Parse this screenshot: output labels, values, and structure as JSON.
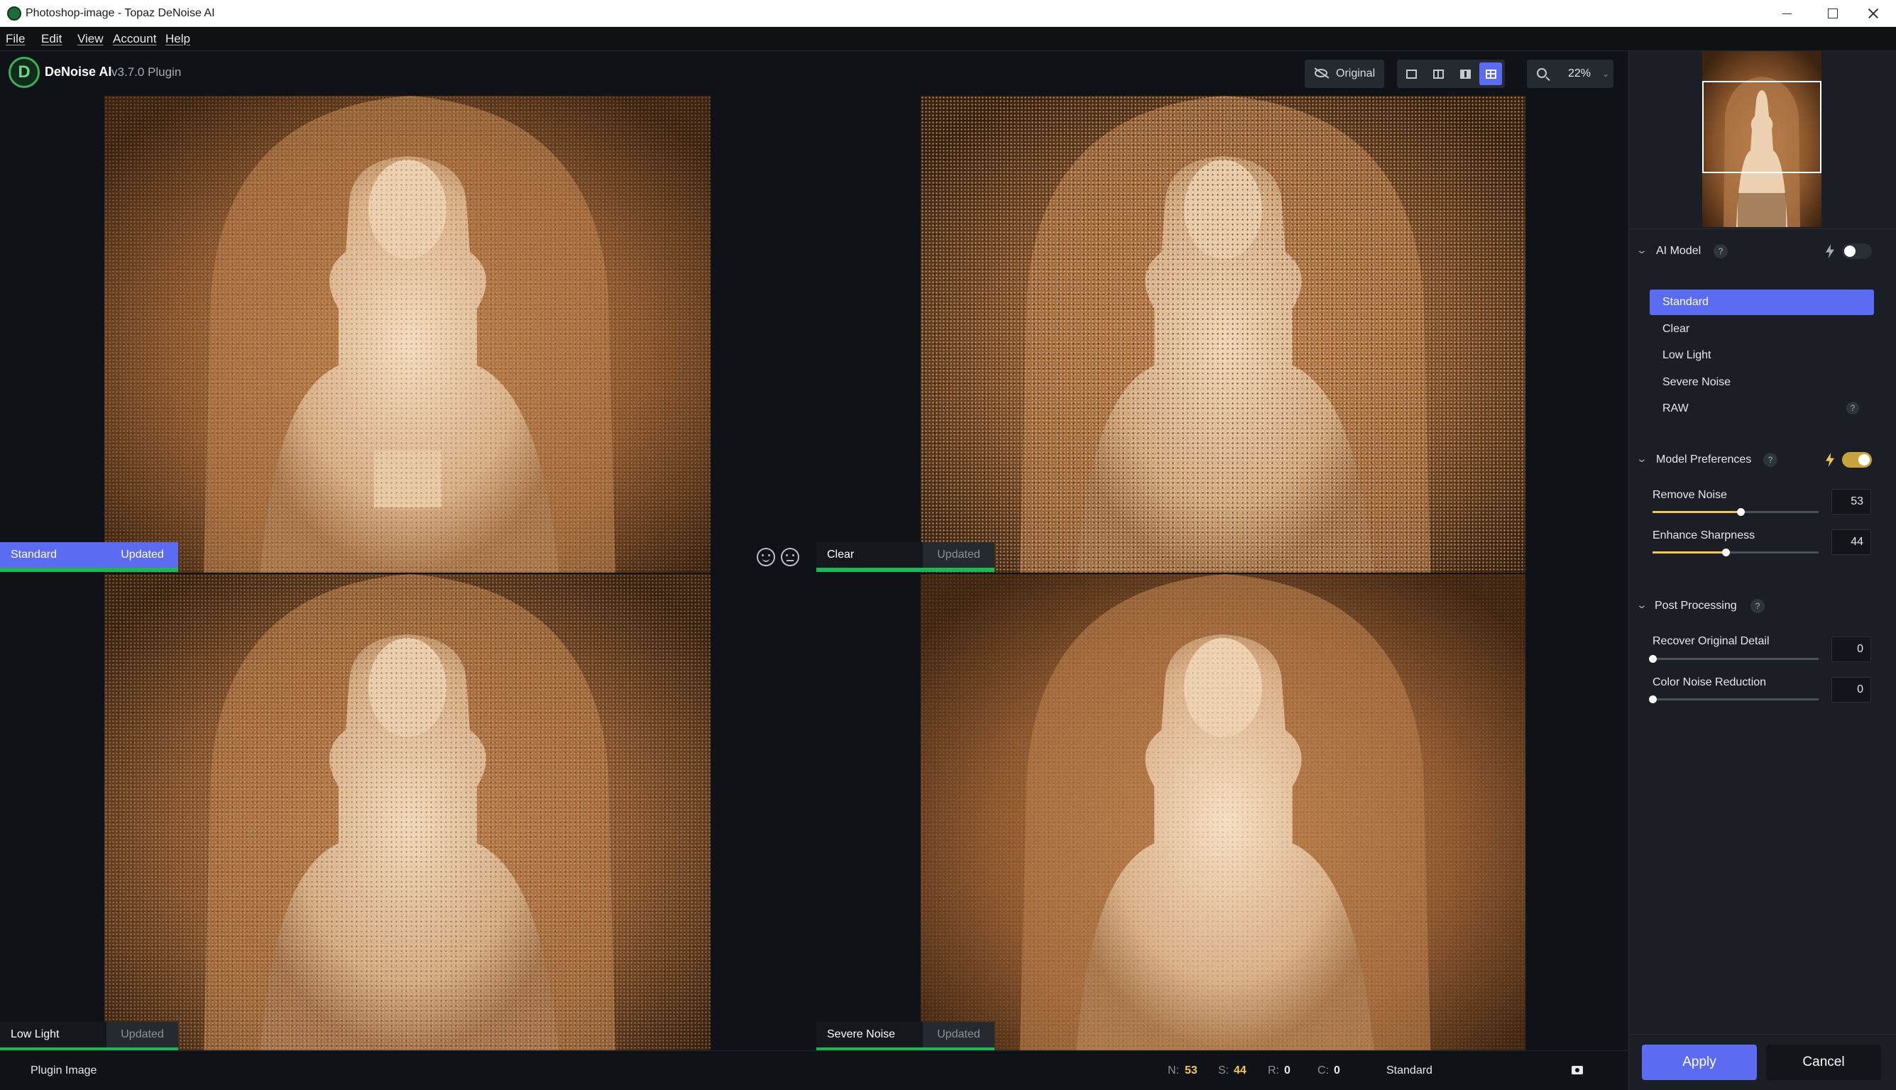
{
  "window": {
    "title": "Photoshop-image - Topaz DeNoise AI"
  },
  "menu": [
    "File",
    "Edit",
    "View",
    "Account",
    "Help"
  ],
  "app": {
    "name": "DeNoise AI",
    "version": "v3.7.0 Plugin"
  },
  "toolbar": {
    "original_label": "Original",
    "zoom": "22%"
  },
  "panels": [
    {
      "name": "Standard",
      "status": "Updated"
    },
    {
      "name": "Clear",
      "status": "Updated"
    },
    {
      "name": "Low Light",
      "status": "Updated"
    },
    {
      "name": "Severe Noise",
      "status": "Updated"
    }
  ],
  "ai_model": {
    "title": "AI Model",
    "help": "?",
    "items": [
      "Standard",
      "Clear",
      "Low Light",
      "Severe Noise",
      "RAW"
    ],
    "raw_help": "?",
    "selected": "Standard"
  },
  "model_preferences": {
    "title": "Model Preferences",
    "help": "?",
    "remove_noise": {
      "label": "Remove Noise",
      "value": "53",
      "level": 0.53
    },
    "enhance_sharpness": {
      "label": "Enhance Sharpness",
      "value": "44",
      "level": 0.44
    }
  },
  "post_processing": {
    "title": "Post Processing",
    "help": "?",
    "recover_detail": {
      "label": "Recover Original Detail",
      "value": "0",
      "level": 0
    },
    "color_noise": {
      "label": "Color Noise Reduction",
      "value": "0",
      "level": 0
    }
  },
  "statusbar": {
    "left": "Plugin Image",
    "n_key": "N:",
    "n_val": "53",
    "s_key": "S:",
    "s_val": "44",
    "r_key": "R:",
    "r_val": "0",
    "c_key": "C:",
    "c_val": "0",
    "model": "Standard"
  },
  "actions": {
    "apply": "Apply",
    "cancel": "Cancel"
  },
  "colors": {
    "accent": "#5b6cf2",
    "green": "#1fb455",
    "gold": "#f2c94c"
  }
}
